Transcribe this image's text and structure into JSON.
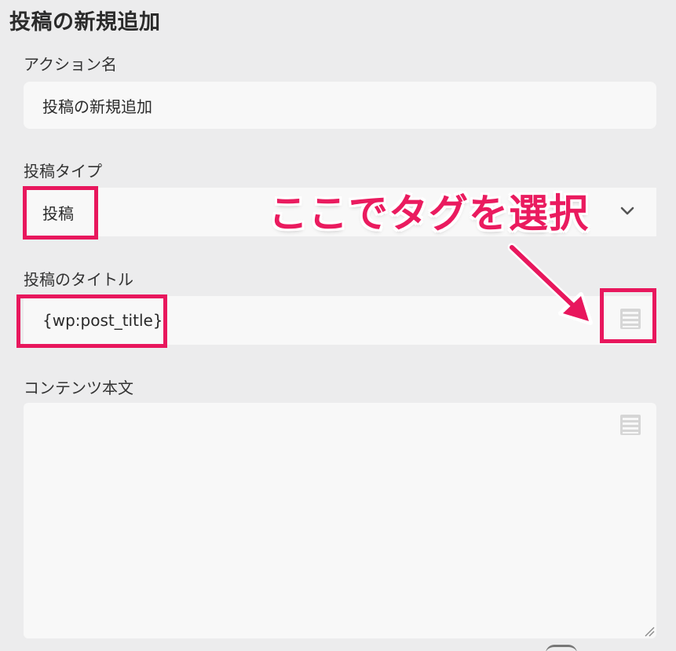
{
  "section": {
    "title": "投稿の新規追加"
  },
  "action_name": {
    "label": "アクション名",
    "value": "投稿の新規追加"
  },
  "post_type": {
    "label": "投稿タイプ",
    "selected": "投稿",
    "icon": "chevron-down-icon"
  },
  "post_title": {
    "label": "投稿のタイトル",
    "value": "{wp:post_title}",
    "tag_icon": "tag-list-icon"
  },
  "content_body": {
    "label": "コンテンツ本文",
    "value": "",
    "tag_icon": "tag-list-icon"
  },
  "annotation": {
    "text": "ここでタグを選択",
    "color": "#ea1b5f"
  },
  "colors": {
    "highlight": "#e8175d",
    "background": "#ececed",
    "field": "#f8f8f8"
  }
}
